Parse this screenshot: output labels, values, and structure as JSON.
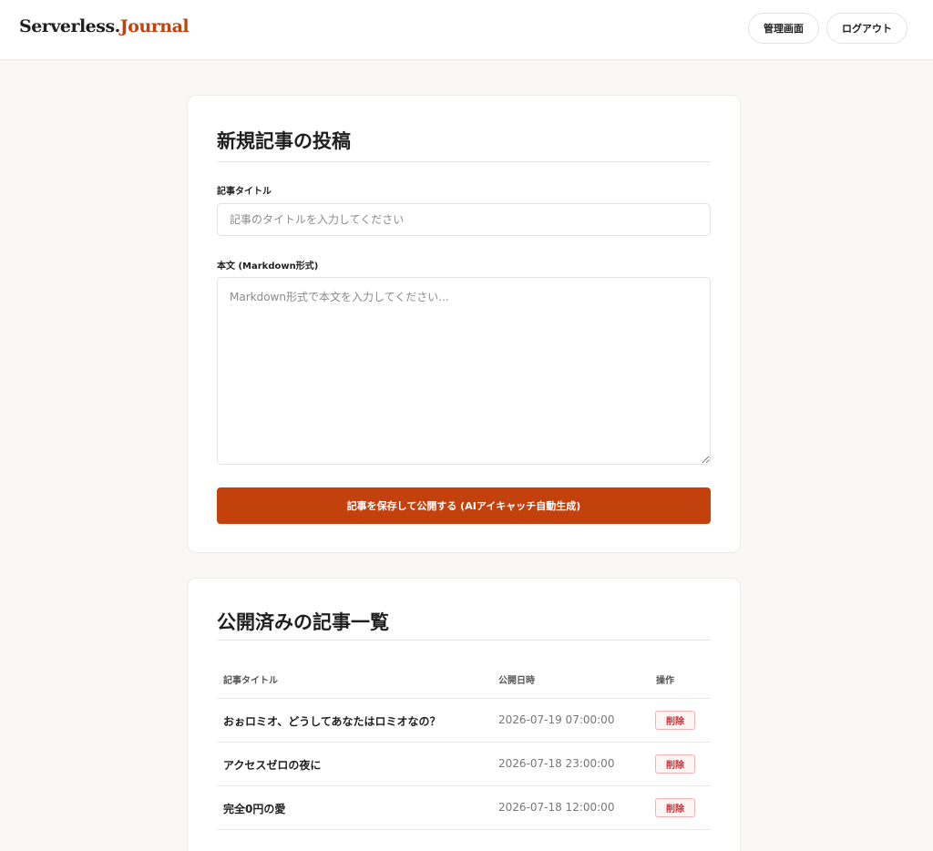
{
  "header": {
    "logo_part1": "Serverless.",
    "logo_part2": "Journal",
    "admin_label": "管理画面",
    "logout_label": "ログアウト"
  },
  "form": {
    "title": "新規記事の投稿",
    "title_label": "記事タイトル",
    "title_placeholder": "記事のタイトルを入力してください",
    "title_value": "",
    "body_label": "本文 (Markdown形式)",
    "body_placeholder": "Markdown形式で本文を入力してください...",
    "body_value": "",
    "submit_label": "記事を保存して公開する (AIアイキャッチ自動生成)"
  },
  "list": {
    "title": "公開済みの記事一覧",
    "columns": [
      "記事タイトル",
      "公開日時",
      "操作"
    ],
    "rows": [
      {
        "title": "おぉロミオ、どうしてあなたはロミオなの？",
        "date": "2026-07-19 07:00:00",
        "action": "削除"
      },
      {
        "title": "アクセスゼロの夜に",
        "date": "2026-07-18 23:00:00",
        "action": "削除"
      },
      {
        "title": "完全0円の愛",
        "date": "2026-07-18 12:00:00",
        "action": "削除"
      }
    ]
  },
  "colors": {
    "accent": "#c2410c",
    "background": "#f9f8f6",
    "danger": "#dc2626"
  }
}
